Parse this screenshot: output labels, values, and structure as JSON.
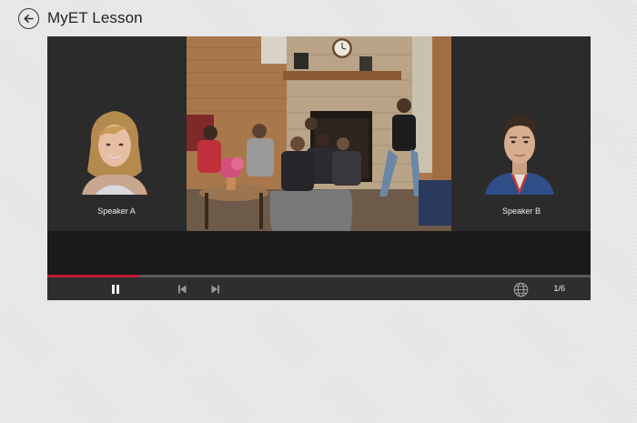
{
  "app": {
    "title": "MyET Lesson"
  },
  "icons": {
    "back": "arrow-left-circle-icon",
    "pause": "pause-icon",
    "prev": "skip-previous-icon",
    "next": "skip-next-icon",
    "language": "globe-icon"
  },
  "speakers": [
    {
      "label": "Speaker A"
    },
    {
      "label": "Speaker B"
    }
  ],
  "player": {
    "progress": 0.17,
    "page_indicator": "1/6"
  },
  "colors": {
    "progress_accent": "#c11b36",
    "player_bg": "#2a2a2a"
  }
}
